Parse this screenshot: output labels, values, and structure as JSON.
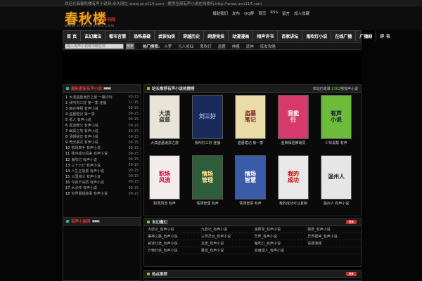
{
  "topbar": {
    "notice": "欢迎光临春秋楼有声小说网-永久网址 www.unn114.com - 提供全部有声小说在线收听,http://www.unn114.com"
  },
  "header": {
    "logo": "春秋楼",
    "logo_sub": "听书网",
    "logo_url": "www.chunqiulou.com",
    "user_links": [
      "捐助我们 ",
      "发布 ",
      "QQ群 ",
      "首页 ",
      "RSS ",
      "留言 ",
      "加入收藏"
    ]
  },
  "nav": {
    "items": [
      "首 页",
      "玄幻魔法",
      "都市言情",
      "恐怖悬疑",
      "武侠仙侠",
      "穿越历史",
      "网游竞技",
      "动漫漫画",
      "相声评书",
      "百家讲坛",
      "鬼吹灯小说",
      "在线广播",
      "广播剧",
      "评 书"
    ]
  },
  "search": {
    "placeholder": "输入有声小说或书籍名称",
    "button": "搜索",
    "hot_label": "热门搜索:",
    "hot_items": [
      "斗罗",
      "凡人修仙",
      "鬼吹灯",
      "盗墓",
      "神墓",
      "武神",
      "庶女攻略"
    ]
  },
  "left_top": {
    "title": "最新更新有声小说",
    "new_tag": "NEW",
    "items": [
      {
        "num": "1",
        "text": "大漠盗墓诡异之旅 一路坎坷",
        "time": "03-13"
      },
      {
        "num": "2",
        "text": "我叫刘三好 第一季 连播",
        "time": "11-15"
      },
      {
        "num": "3",
        "text": "麻衣神相 有声小说",
        "time": "09-15"
      },
      {
        "num": "4",
        "text": "盗墓笔记 第一季",
        "time": "09-15"
      },
      {
        "num": "5",
        "text": "纸人 有声小说",
        "time": "09-15"
      },
      {
        "num": "6",
        "text": "黑道教父 有声小说",
        "time": "09-15"
      },
      {
        "num": "7",
        "text": "幽冥之地 有声小说",
        "time": "09-15"
      },
      {
        "num": "8",
        "text": "清朝秘史 有声小说",
        "time": "09-15"
      },
      {
        "num": "9",
        "text": "倚天屠龙 有声小说",
        "time": "09-15"
      },
      {
        "num": "10",
        "text": "情场高手 有声小说",
        "time": "09-15"
      },
      {
        "num": "11",
        "text": "我叫成功后来 有声小说",
        "time": "09-15"
      },
      {
        "num": "12",
        "text": "鬼吹灯 有声小说",
        "time": "09-15"
      },
      {
        "num": "13",
        "text": "三十六计 有声小说",
        "time": "09-15"
      },
      {
        "num": "14",
        "text": "人生正能量 有声小说",
        "time": "09-15"
      },
      {
        "num": "15",
        "text": "三国演义 有声小说",
        "time": "09-15"
      },
      {
        "num": "16",
        "text": "今夜不设防 有声小说",
        "time": "09-15"
      },
      {
        "num": "17",
        "text": "水浒传 有声小说",
        "time": "09-15"
      },
      {
        "num": "18",
        "text": "世界悬疑故事 有声小说",
        "time": "09-15"
      }
    ]
  },
  "left_bottom": {
    "title": "有声小说网"
  },
  "featured": {
    "title": "站长推荐有声小说热播榜",
    "stats_label": "本站已收录:",
    "stats_value": "1362",
    "stats_tail": "部有声小说",
    "books": [
      {
        "title": "大漠盗墓诡异之旅",
        "cover_text": "大漠\n盗墓",
        "bg": "#e8e4d8",
        "fg": "#333"
      },
      {
        "title": "我叫刘三好 连播",
        "cover_text": "刘三好",
        "bg": "#1a2a5a",
        "fg": "#9bd"
      },
      {
        "title": "盗墓笔记 第一季",
        "cover_text": "盗墓\n笔记",
        "bg": "#e9dca8",
        "fg": "#7a1f1f"
      },
      {
        "title": "金牌保险推销员",
        "cover_text": "我能\n行",
        "bg": "#d63a6c",
        "fg": "#ffe"
      },
      {
        "title": "少年黑帮 有声",
        "cover_text": "有声\n小说",
        "bg": "#6dbb3b",
        "fg": "#113"
      },
      {
        "title": "职场风流 有声",
        "cover_text": "职场\n风流",
        "bg": "#f3ecec",
        "fg": "#c03"
      },
      {
        "title": "情场管理 有声",
        "cover_text": "情场\n管理",
        "bg": "#2e5d3a",
        "fg": "#ffeb9a"
      },
      {
        "title": "情场智慧 有声",
        "cover_text": "情场\n智慧",
        "bg": "#3a5ba8",
        "fg": "#fff"
      },
      {
        "title": "我的成功可以复制",
        "cover_text": "我的\n成功",
        "bg": "#e8e8e8",
        "fg": "#c00"
      },
      {
        "title": "温州人 有声小说",
        "cover_text": "温州人",
        "bg": "#e6e6e6",
        "fg": "#222"
      }
    ]
  },
  "recommend": {
    "title": "玄幻魔幻",
    "more": "更多",
    "rows": [
      [
        "大唐记_有声小说",
        "九鼎记_有声小说",
        "凌霄琴_有声小说",
        "飘渺_有声小说"
      ],
      [
        "屠神之路_有声小说",
        "三界灵玩_有声小说",
        "异界_有声小说",
        "异界猎神_有声小说"
      ],
      [
        "官道仕途_有声小说",
        "龙途_有声小说",
        "鬼吹灯_有声小说",
        "青楼演绎"
      ],
      [
        "万物归宗_有声小说",
        "暴道_有声小说",
        "追魂猎人_有声小说",
        ""
      ]
    ]
  },
  "bottom": {
    "title": "热点推荐",
    "more": "更多"
  },
  "colors": {
    "accent_red": "#e33",
    "logo_gold": "#e6a020"
  }
}
